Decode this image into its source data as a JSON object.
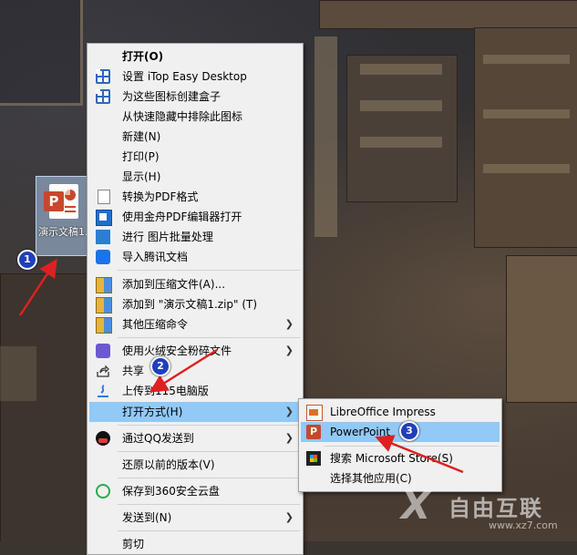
{
  "desktop": {
    "icon_label": "演示文稿1.pptx"
  },
  "menu": {
    "items": [
      {
        "label": "打开(O)",
        "icon": "none"
      },
      {
        "label": "设置 iTop Easy Desktop",
        "icon": "itop-icon"
      },
      {
        "label": "为这些图标创建盒子",
        "icon": "itop-icon"
      },
      {
        "label": "从快速隐藏中排除此图标",
        "icon": "none"
      },
      {
        "label": "新建(N)",
        "icon": "none"
      },
      {
        "label": "打印(P)",
        "icon": "none"
      },
      {
        "label": "显示(H)",
        "icon": "none"
      },
      {
        "label": "转换为PDF格式",
        "icon": "document-icon"
      },
      {
        "label": "使用金舟PDF编辑器打开",
        "icon": "pdf-editor-icon"
      },
      {
        "label": "进行 图片批量处理",
        "icon": "batch-image-icon"
      },
      {
        "label": "导入腾讯文档",
        "icon": "tencent-docs-icon"
      },
      {
        "label": "添加到压缩文件(A)...",
        "icon": "archive-icon"
      },
      {
        "label": "添加到 \"演示文稿1.zip\" (T)",
        "icon": "archive-icon"
      },
      {
        "label": "其他压缩命令",
        "icon": "archive-icon"
      },
      {
        "label": "使用火绒安全粉碎文件",
        "icon": "huorong-shred-icon"
      },
      {
        "label": "共享",
        "icon": "share-icon"
      },
      {
        "label": "上传到115电脑版",
        "icon": "cloud-115-icon"
      },
      {
        "label": "打开方式(H)",
        "icon": "none"
      },
      {
        "label": "通过QQ发送到",
        "icon": "qq-icon"
      },
      {
        "label": "还原以前的版本(V)",
        "icon": "none"
      },
      {
        "label": "保存到360安全云盘",
        "icon": "cloud-360-icon"
      },
      {
        "label": "发送到(N)",
        "icon": "none"
      },
      {
        "label": "剪切",
        "icon": "none"
      }
    ]
  },
  "submenu": {
    "items": [
      {
        "label": "LibreOffice Impress",
        "icon": "libreoffice-impress-icon"
      },
      {
        "label": "PowerPoint",
        "icon": "powerpoint-icon"
      },
      {
        "label": "搜索 Microsoft Store(S)",
        "icon": "microsoft-store-icon"
      },
      {
        "label": "选择其他应用(C)",
        "icon": "none"
      }
    ]
  },
  "annotations": {
    "badges": [
      "1",
      "2",
      "3"
    ],
    "arrow_color": "#e02020"
  },
  "watermark": {
    "text": "自由互联",
    "url": "www.xz7.com"
  },
  "colors": {
    "highlight": "#91c9f7",
    "menu_bg": "#f0f0f0",
    "badge": "#1f3fbf"
  }
}
